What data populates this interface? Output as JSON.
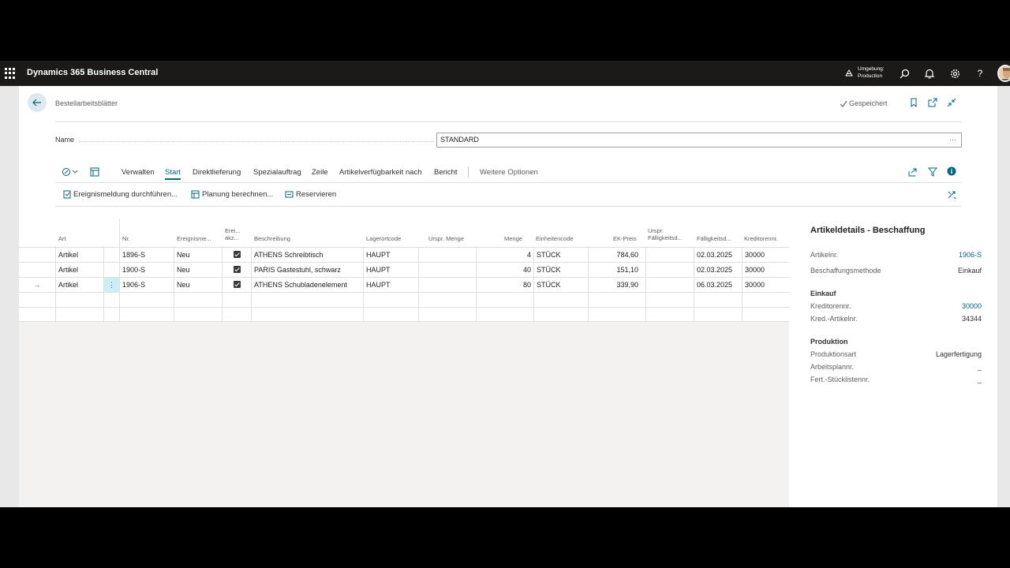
{
  "app": {
    "title": "Dynamics 365 Business Central"
  },
  "environment": {
    "label": "Umgebung:",
    "value": "Production"
  },
  "header": {
    "breadcrumb": "Bestellarbeitsblätter",
    "saved_label": "Gespeichert"
  },
  "name_field": {
    "label": "Name",
    "value": "STANDARD"
  },
  "actionbar": {
    "items": [
      "Verwalten",
      "Start",
      "Direktlieferung",
      "Spezialauftrag",
      "Zeile",
      "Artikelverfügbarkeit nach",
      "Bericht"
    ],
    "more": "Weitere Optionen",
    "active": "Start"
  },
  "promoted": [
    "Ereignismeldung durchführen...",
    "Planung berechnen...",
    "Reservieren"
  ],
  "grid": {
    "columns": [
      "Art",
      "Nr.",
      "Ereignisme...",
      "Erei... akz...",
      "Beschreibung",
      "Lagerortcode",
      "Urspr. Menge",
      "Menge",
      "Einheitencode",
      "EK-Preis",
      "Urspr. Fälligkeitsd...",
      "Fälligkeitsd...",
      "Kreditorennr."
    ],
    "rows": [
      {
        "art": "Artikel",
        "nr": "1896-S",
        "ereignis": "Neu",
        "akz": true,
        "beschreibung": "ATHENS Schreibtisch",
        "lagerort": "HAUPT",
        "urspr_menge": "",
        "menge": "4",
        "einheit": "STÜCK",
        "ek_preis": "784,60",
        "urspr_faellig": "",
        "faellig": "02.03.2025",
        "kreditor": "30000"
      },
      {
        "art": "Artikel",
        "nr": "1900-S",
        "ereignis": "Neu",
        "akz": true,
        "beschreibung": "PARIS Gastestuhl, schwarz",
        "lagerort": "HAUPT",
        "urspr_menge": "",
        "menge": "40",
        "einheit": "STÜCK",
        "ek_preis": "151,10",
        "urspr_faellig": "",
        "faellig": "02.03.2025",
        "kreditor": "30000"
      },
      {
        "art": "Artikel",
        "nr": "1906-S",
        "ereignis": "Neu",
        "akz": true,
        "beschreibung": "ATHENS Schubladenelement",
        "lagerort": "HAUPT",
        "urspr_menge": "",
        "menge": "80",
        "einheit": "STÜCK",
        "ek_preis": "339,90",
        "urspr_faellig": "",
        "faellig": "06.03.2025",
        "kreditor": "30000"
      }
    ]
  },
  "factbox": {
    "title": "Artikeldetails - Beschaffung",
    "artikelnr_label": "Artikelnr.",
    "artikelnr_value": "1906-S",
    "methode_label": "Beschaffungsmethode",
    "methode_value": "Einkauf",
    "einkauf_section": "Einkauf",
    "kreditor_label": "Kreditorennr.",
    "kreditor_value": "30000",
    "kred_art_label": "Kred.-Artikelnr.",
    "kred_art_value": "34344",
    "produktion_section": "Produktion",
    "prodart_label": "Produktionsart",
    "prodart_value": "Lagerfertigung",
    "arbeitsplan_label": "Arbeitsplannr.",
    "arbeitsplan_value": "_",
    "stueckliste_label": "Fert.-Stücklistennr.",
    "stueckliste_value": "_"
  },
  "colors": {
    "accent": "#00677e",
    "appbar": "#1b1a19"
  }
}
